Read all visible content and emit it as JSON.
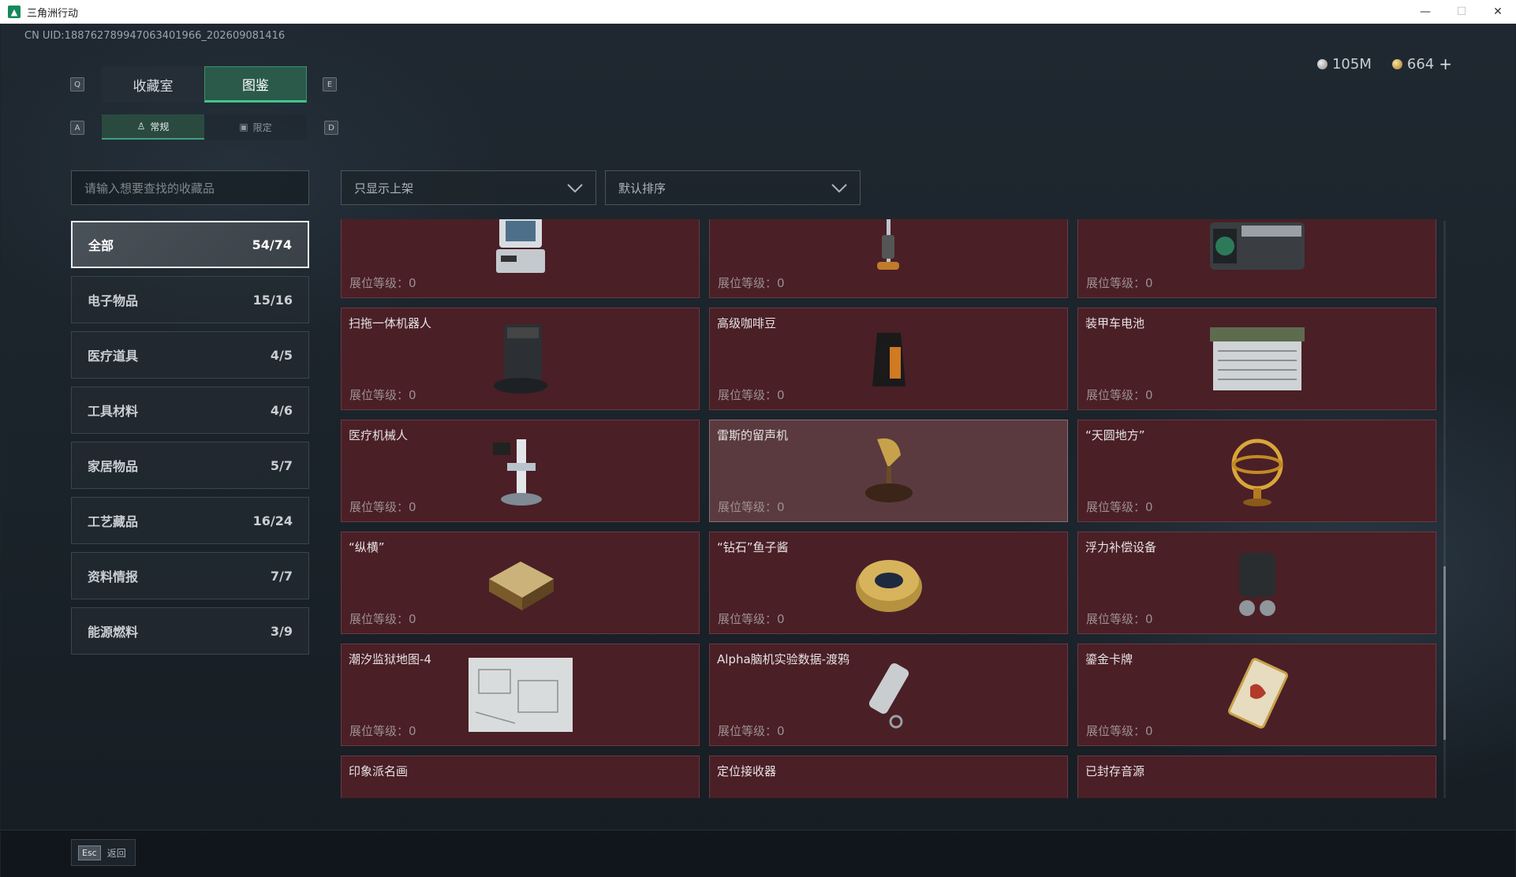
{
  "window": {
    "title": "三角洲行动"
  },
  "uid": "CN UID:1887627899470634019​66_202609081416",
  "currency": {
    "silver": "105M",
    "gold": "664",
    "plus": "+"
  },
  "keys": {
    "q": "Q",
    "e": "E",
    "a": "A",
    "d": "D"
  },
  "main_tabs": [
    {
      "label": "收藏室"
    },
    {
      "label": "图鉴"
    }
  ],
  "sub_tabs": [
    {
      "label": "常规"
    },
    {
      "label": "限定"
    }
  ],
  "search": {
    "placeholder": "请输入想要查找的收藏品"
  },
  "filters": {
    "shelf": "只显示上架",
    "sort": "默认排序"
  },
  "categories": [
    {
      "label": "全部",
      "count": "54/74"
    },
    {
      "label": "电子物品",
      "count": "15/16"
    },
    {
      "label": "医疗道具",
      "count": "4/5"
    },
    {
      "label": "工具材料",
      "count": "4/6"
    },
    {
      "label": "家居物品",
      "count": "5/7"
    },
    {
      "label": "工艺藏品",
      "count": "16/24"
    },
    {
      "label": "资料情报",
      "count": "7/7"
    },
    {
      "label": "能源燃料",
      "count": "3/9"
    }
  ],
  "level_label": "展位等级：",
  "items": [
    {
      "name": "",
      "level": "0",
      "icon": "arcade-machine-icon"
    },
    {
      "name": "",
      "level": "0",
      "icon": "vacuum-cleaner-icon"
    },
    {
      "name": "",
      "level": "0",
      "icon": "graphics-card-icon"
    },
    {
      "name": "扫拖一体机器人",
      "level": "0",
      "icon": "robot-mop-icon"
    },
    {
      "name": "高级咖啡豆",
      "level": "0",
      "icon": "coffee-beans-icon"
    },
    {
      "name": "装甲车电池",
      "level": "0",
      "icon": "vehicle-battery-icon"
    },
    {
      "name": "医疗机械人",
      "level": "0",
      "icon": "medical-robot-icon"
    },
    {
      "name": "雷斯的留声机",
      "level": "0",
      "icon": "gramophone-icon"
    },
    {
      "name": "“天圆地方”",
      "level": "0",
      "icon": "armillary-sphere-icon"
    },
    {
      "name": "“纵横”",
      "level": "0",
      "icon": "chess-board-icon"
    },
    {
      "name": "“钻石”鱼子酱",
      "level": "0",
      "icon": "caviar-tin-icon"
    },
    {
      "name": "浮力补偿设备",
      "level": "0",
      "icon": "buoyancy-device-icon"
    },
    {
      "name": "潮汐监狱地图-4",
      "level": "0",
      "icon": "prison-map-icon"
    },
    {
      "name": "Alpha脑机实验数据-渡鸦",
      "level": "0",
      "icon": "data-cylinder-icon"
    },
    {
      "name": "鎏金卡牌",
      "level": "0",
      "icon": "gilded-card-icon"
    },
    {
      "name": "印象派名画",
      "level": "",
      "icon": "painting-icon"
    },
    {
      "name": "定位接收器",
      "level": "",
      "icon": "locator-receiver-icon"
    },
    {
      "name": "已封存音源",
      "level": "",
      "icon": "sealed-audio-icon"
    }
  ],
  "footer": {
    "esc_key": "Esc",
    "back_label": "返回"
  },
  "colors": {
    "accent": "#43c48d",
    "card_bg": "#4a1f26",
    "card_border": "#6b3a40"
  }
}
